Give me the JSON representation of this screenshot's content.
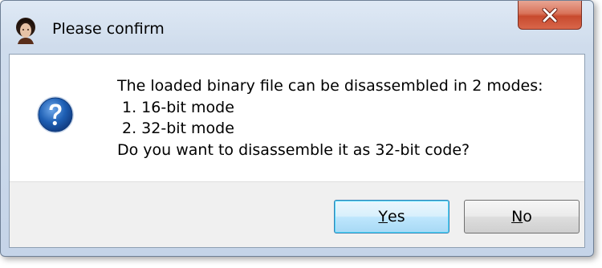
{
  "window": {
    "title": "Please confirm",
    "close_label": "X"
  },
  "message": {
    "line1": "The loaded binary file can be disassembled in 2 modes:",
    "line2": "1. 16-bit mode",
    "line3": "2. 32-bit mode",
    "line4": "Do you want to disassemble it as 32-bit code?"
  },
  "buttons": {
    "yes": {
      "mnemonic": "Y",
      "rest": "es"
    },
    "no": {
      "mnemonic": "N",
      "rest": "o"
    }
  },
  "icons": {
    "app": "app-portrait-icon",
    "question": "question-icon",
    "close": "close-icon"
  },
  "colors": {
    "close_button": "#c84a2e",
    "question_icon": "#1e5fb4",
    "default_button_border": "#3c7fb1"
  }
}
